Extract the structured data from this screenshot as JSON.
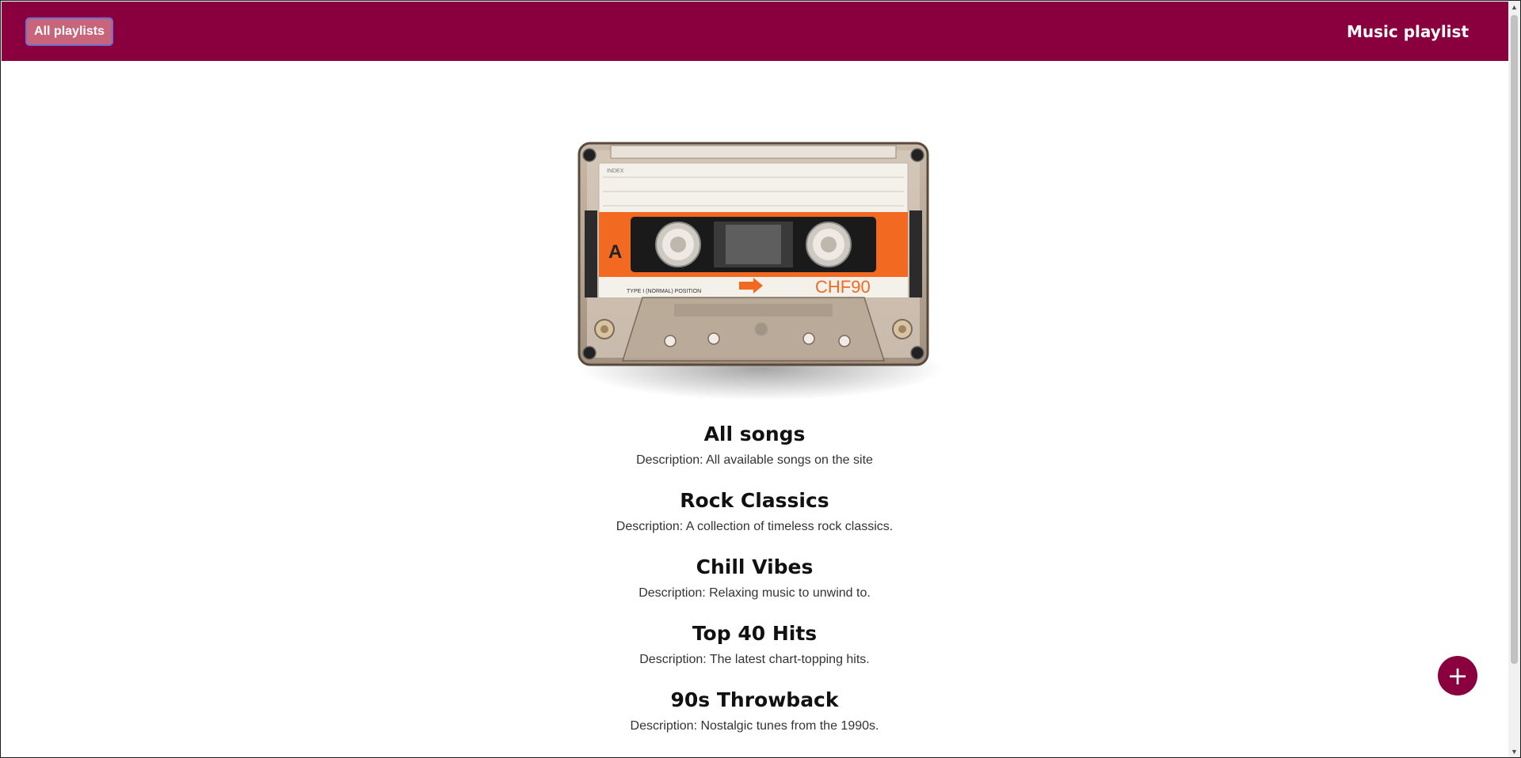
{
  "header": {
    "all_playlists_label": "All playlists",
    "brand": "Music playlist"
  },
  "cassette": {
    "index_label": "INDEX",
    "side": "A",
    "type_label": "TYPE I (NORMAL) POSITION",
    "model": "CHF90"
  },
  "playlists": [
    {
      "title": "All songs",
      "description": "Description: All available songs on the site"
    },
    {
      "title": "Rock Classics",
      "description": "Description: A collection of timeless rock classics."
    },
    {
      "title": "Chill Vibes",
      "description": "Description: Relaxing music to unwind to."
    },
    {
      "title": "Top 40 Hits",
      "description": "Description: The latest chart-topping hits."
    },
    {
      "title": "90s Throwback",
      "description": "Description: Nostalgic tunes from the 1990s."
    }
  ],
  "fab": {
    "label": "+"
  },
  "icons": {
    "fab": "plus-icon",
    "scroll_up": "chevron-up-icon",
    "scroll_down": "chevron-down-icon"
  },
  "colors": {
    "brand": "#8a003e",
    "button_bg": "#c8657b",
    "button_border": "#6b6fd3",
    "cassette_orange": "#f26a21"
  }
}
